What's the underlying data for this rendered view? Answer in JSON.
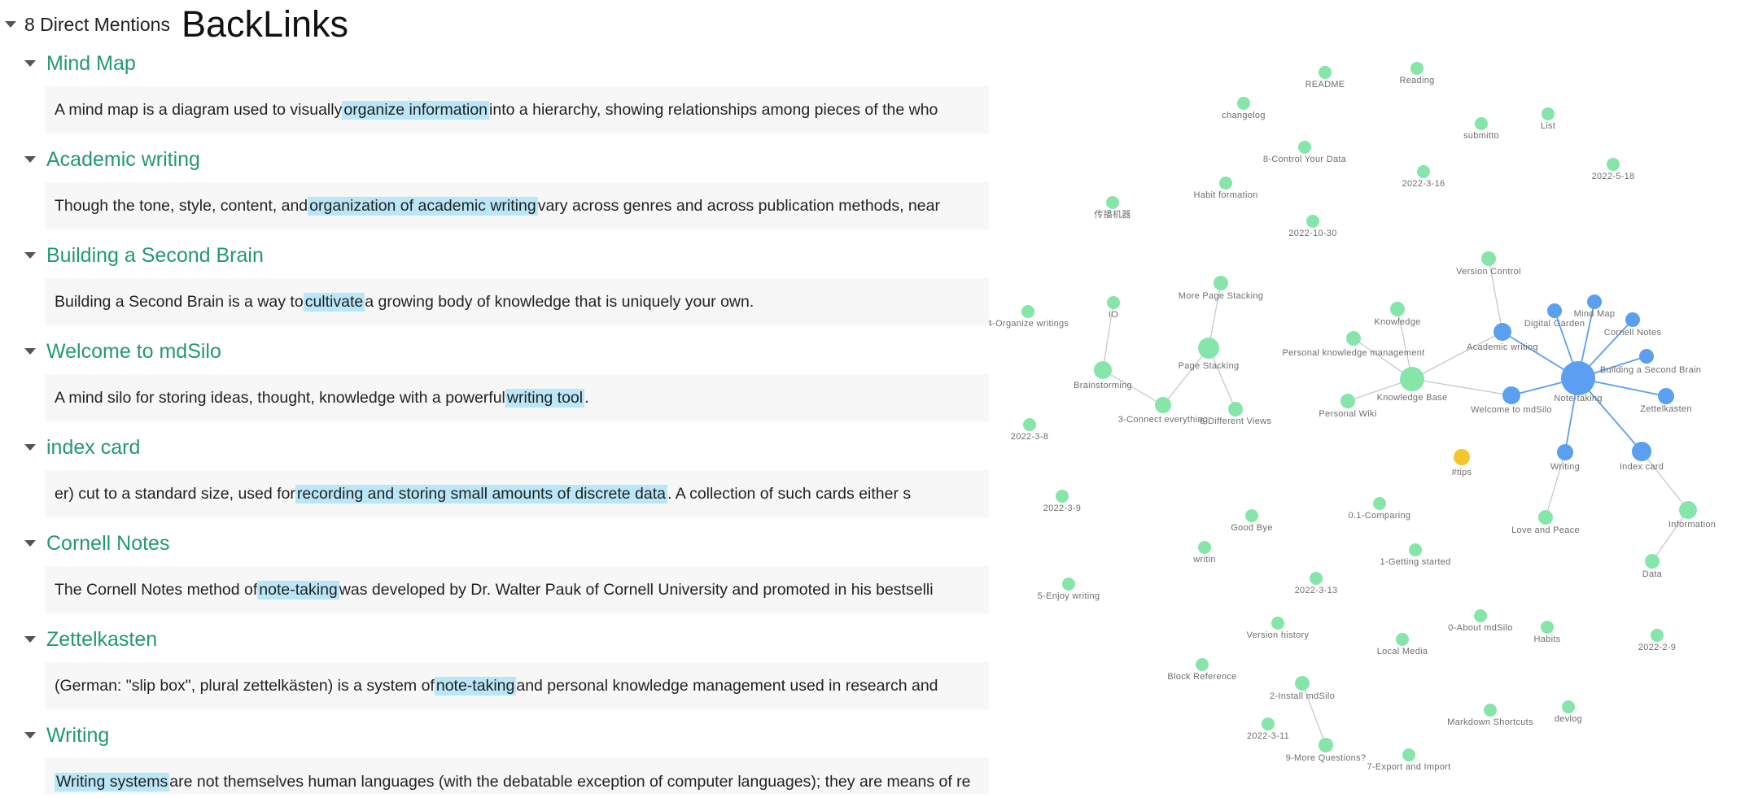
{
  "backlinks": {
    "mentions_label": "8 Direct Mentions",
    "title": "BackLinks",
    "items": [
      {
        "title": "Mind Map",
        "pre": "A mind map is a diagram used to visually ",
        "hl": "organize information",
        "post": " into a hierarchy, showing relationships among pieces of the who"
      },
      {
        "title": "Academic writing",
        "pre": "Though the tone, style, content, and ",
        "hl": "organization of academic writing",
        "post": " vary across genres and across publication methods, near"
      },
      {
        "title": "Building a Second Brain",
        "pre": "Building a Second Brain is a way to ",
        "hl": "cultivate",
        "post": " a growing body of  knowledge  that is uniquely your own."
      },
      {
        "title": "Welcome to mdSilo",
        "pre": "A mind silo for  storing ideas, thought, knowledge  with a powerful ",
        "hl": "writing tool",
        "post": "."
      },
      {
        "title": "index card",
        "pre": "er) cut to a standard size, used for ",
        "hl": "recording and storing small amounts of discrete data",
        "post": ". A collection of such cards either s"
      },
      {
        "title": "Cornell Notes",
        "pre": "The Cornell Notes method of ",
        "hl": "note-taking",
        "post": " was developed by Dr. Walter Pauk of Cornell University and promoted in his bestselli"
      },
      {
        "title": "Zettelkasten",
        "pre": "(German: \"slip box\", plural zettelkästen) is a system of ",
        "hl": "note-taking",
        "post": " and  personal knowledge management  used in research and"
      },
      {
        "title": "Writing",
        "pre": "",
        "hl": "Writing systems",
        "post": " are not themselves human languages (with the debatable exception of computer languages); they are means of re"
      }
    ]
  },
  "graph": {
    "colors": {
      "note": "#86e5a9",
      "linked": "#5b9ff0",
      "tag": "#f6c42b",
      "edge_green": "#c5c9cd",
      "edge_blue": "#5b9ff0",
      "label": "#6e6e6e"
    },
    "nodes": [
      {
        "label": "README",
        "kind": "note"
      },
      {
        "label": "Reading",
        "kind": "note"
      },
      {
        "label": "changelog",
        "kind": "note"
      },
      {
        "label": "submitto",
        "kind": "note"
      },
      {
        "label": "List",
        "kind": "note"
      },
      {
        "label": "8-Control Your Data",
        "kind": "note"
      },
      {
        "label": "2022-3-16",
        "kind": "note"
      },
      {
        "label": "2022-5-18",
        "kind": "note"
      },
      {
        "label": "Habit formation",
        "kind": "note"
      },
      {
        "label": "传播机器",
        "kind": "note"
      },
      {
        "label": "2022-10-30",
        "kind": "note"
      },
      {
        "label": "Version Control",
        "kind": "note"
      },
      {
        "label": "More Page Stacking",
        "kind": "note"
      },
      {
        "label": "IO",
        "kind": "note"
      },
      {
        "label": "4-Organize writings",
        "kind": "note"
      },
      {
        "label": "Knowledge",
        "kind": "note"
      },
      {
        "label": "Personal knowledge management",
        "kind": "note"
      },
      {
        "label": "Page Stacking",
        "kind": "note"
      },
      {
        "label": "Brainstorming",
        "kind": "note"
      },
      {
        "label": "Knowledge Base",
        "kind": "note"
      },
      {
        "label": "Personal Wiki",
        "kind": "note"
      },
      {
        "label": "3-Connect everything",
        "kind": "note"
      },
      {
        "label": "6-Different Views",
        "kind": "note"
      },
      {
        "label": "2022-3-8",
        "kind": "note"
      },
      {
        "label": "Digital Garden",
        "kind": "linked"
      },
      {
        "label": "Mind Map",
        "kind": "linked"
      },
      {
        "label": "Cornell Notes",
        "kind": "linked"
      },
      {
        "label": "Academic writing",
        "kind": "linked"
      },
      {
        "label": "Building a Second Brain",
        "kind": "linked"
      },
      {
        "label": "Note-taking",
        "kind": "linked"
      },
      {
        "label": "Welcome to mdSilo",
        "kind": "linked"
      },
      {
        "label": "Zettelkasten",
        "kind": "linked"
      },
      {
        "label": "#tips",
        "kind": "tag"
      },
      {
        "label": "Writing",
        "kind": "linked"
      },
      {
        "label": "Index card",
        "kind": "linked"
      },
      {
        "label": "Information",
        "kind": "note"
      },
      {
        "label": "Love and Peace",
        "kind": "note"
      },
      {
        "label": "Data",
        "kind": "note"
      },
      {
        "label": "2022-3-9",
        "kind": "note"
      },
      {
        "label": "Good Bye",
        "kind": "note"
      },
      {
        "label": "0.1-Comparing",
        "kind": "note"
      },
      {
        "label": "writin",
        "kind": "note"
      },
      {
        "label": "1-Getting started",
        "kind": "note"
      },
      {
        "label": "5-Enjoy writing",
        "kind": "note"
      },
      {
        "label": "2022-3-13",
        "kind": "note"
      },
      {
        "label": "Version history",
        "kind": "note"
      },
      {
        "label": "0-About mdSilo",
        "kind": "note"
      },
      {
        "label": "Local Media",
        "kind": "note"
      },
      {
        "label": "Habits",
        "kind": "note"
      },
      {
        "label": "2022-2-9",
        "kind": "note"
      },
      {
        "label": "Block Reference",
        "kind": "note"
      },
      {
        "label": "2-Install mdSilo",
        "kind": "note"
      },
      {
        "label": "Markdown Shortcuts",
        "kind": "note"
      },
      {
        "label": "devlog",
        "kind": "note"
      },
      {
        "label": "2022-3-11",
        "kind": "note"
      },
      {
        "label": "9-More Questions?",
        "kind": "note"
      },
      {
        "label": "7-Export and Import",
        "kind": "note"
      }
    ]
  }
}
